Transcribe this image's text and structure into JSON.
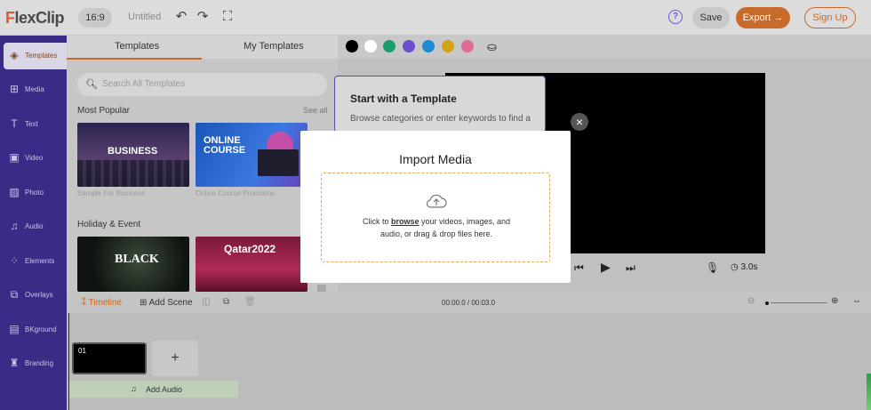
{
  "app": {
    "logo": "lexClip",
    "logo_mark": "F"
  },
  "topbar": {
    "ratio": "16:9",
    "title": "Untitled",
    "save": "Save",
    "export": "Export →",
    "signup": "Sign Up",
    "help": "?"
  },
  "sidebar": {
    "items": [
      {
        "label": "Templates",
        "icon": "layers-icon"
      },
      {
        "label": "Media",
        "icon": "media-icon"
      },
      {
        "label": "Text",
        "icon": "text-icon"
      },
      {
        "label": "Video",
        "icon": "video-icon"
      },
      {
        "label": "Photo",
        "icon": "photo-icon"
      },
      {
        "label": "Audio",
        "icon": "audio-icon"
      },
      {
        "label": "Elements",
        "icon": "elements-icon"
      },
      {
        "label": "Overlays",
        "icon": "overlays-icon"
      },
      {
        "label": "BKground",
        "icon": "background-icon"
      },
      {
        "label": "Branding",
        "icon": "branding-icon"
      }
    ]
  },
  "panel": {
    "tabs": [
      "Templates",
      "My Templates"
    ],
    "search_placeholder": "Search All Templates",
    "most_popular": "Most Popular",
    "see_all": "See all",
    "holiday": "Holiday & Event",
    "thumbs": [
      {
        "text": "BUSINESS",
        "caption": "Sample For Business"
      },
      {
        "text": "ONLINE COURSE",
        "caption": "Online Course Promotion"
      },
      {
        "text": "BLACK",
        "caption": ""
      },
      {
        "text": "Qatar2022",
        "caption": ""
      }
    ]
  },
  "colors": [
    "#000000",
    "#ffffff",
    "#1a9e6e",
    "#6a4fd0",
    "#1f8ad6",
    "#d4a217",
    "#e06a9a"
  ],
  "tooltip": {
    "heading": "Start with a Template",
    "body": "Browse categories or enter keywords to find a"
  },
  "player": {
    "duration": "3.0s"
  },
  "timeline": {
    "tab": "Timeline",
    "add_scene": "Add Scene",
    "time": "00:00.0 / 00:03.0",
    "clip_number": "01",
    "add_audio": "Add Audio"
  },
  "modal": {
    "title": "Import Media",
    "line1_pre": "Click to ",
    "browse": "browse",
    "line1_post": " your videos, images, and",
    "line2": "audio, or drag & drop files here."
  }
}
